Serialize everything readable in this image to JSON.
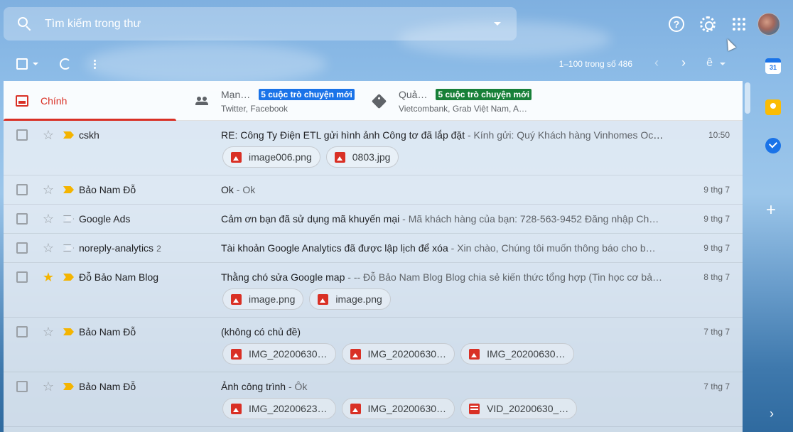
{
  "search": {
    "placeholder": "Tìm kiếm trong thư"
  },
  "header": {
    "help_icon": "help-icon",
    "settings_icon": "gear-icon",
    "apps_icon": "apps-icon"
  },
  "toolbar": {
    "pagination": "1–100 trong số 486"
  },
  "tabs": [
    {
      "name": "Chính",
      "badge": "",
      "subtitle": ""
    },
    {
      "name": "Mạn…",
      "badge": "5 cuộc trò chuyện mới",
      "subtitle": "Twitter, Facebook"
    },
    {
      "name": "Quả…",
      "badge": "5 cuộc trò chuyện mới",
      "subtitle": "Vietcombank, Grab Việt Nam, A…"
    }
  ],
  "emails": [
    {
      "sender": "cskh",
      "count": "",
      "starred": false,
      "important": true,
      "subject": "RE: Công Ty Điện ETL gửi hình ảnh Công tơ đã lắp đặt",
      "snippet": " - Kính gửi: Quý Khách hàng Vinhomes Oce…",
      "date": "10:50",
      "attachments": [
        {
          "name": "image006.png",
          "type": "img"
        },
        {
          "name": "0803.jpg",
          "type": "img"
        }
      ]
    },
    {
      "sender": "Bảo Nam Đỗ",
      "count": "",
      "starred": false,
      "important": true,
      "subject": "Ok",
      "snippet": " - Ok",
      "date": "9 thg 7",
      "attachments": []
    },
    {
      "sender": "Google Ads",
      "count": "",
      "starred": false,
      "important": false,
      "subject": "Cảm ơn bạn đã sử dụng mã khuyến mại",
      "snippet": " - Mã khách hàng của bạn: 728-563-9452 Đăng nhập Ch…",
      "date": "9 thg 7",
      "attachments": []
    },
    {
      "sender": "noreply-analytics",
      "count": "2",
      "starred": false,
      "important": false,
      "subject": "Tài khoản Google Analytics đã được lập lịch để xóa",
      "snippet": " - Xin chào, Chúng tôi muốn thông báo cho b…",
      "date": "9 thg 7",
      "attachments": []
    },
    {
      "sender": "Đỗ Bảo Nam Blog",
      "count": "",
      "starred": true,
      "important": true,
      "subject": "Thằng chó sửa Google map",
      "snippet": " - -- Đỗ Bảo Nam Blog Blog chia sẻ kiến thức tổng hợp (Tin học cơ bả…",
      "date": "8 thg 7",
      "attachments": [
        {
          "name": "image.png",
          "type": "img"
        },
        {
          "name": "image.png",
          "type": "img"
        }
      ]
    },
    {
      "sender": "Bảo Nam Đỗ",
      "count": "",
      "starred": false,
      "important": true,
      "subject": "(không có chủ đề)",
      "snippet": "",
      "date": "7 thg 7",
      "attachments": [
        {
          "name": "IMG_20200630…",
          "type": "img"
        },
        {
          "name": "IMG_20200630…",
          "type": "img"
        },
        {
          "name": "IMG_20200630…",
          "type": "img"
        }
      ]
    },
    {
      "sender": "Bảo Nam Đỗ",
      "count": "",
      "starred": false,
      "important": true,
      "subject": "Ảnh công trình",
      "snippet": " - Ôk",
      "date": "7 thg 7",
      "attachments": [
        {
          "name": "IMG_20200623…",
          "type": "img"
        },
        {
          "name": "IMG_20200630…",
          "type": "img"
        },
        {
          "name": "VID_20200630_…",
          "type": "vid"
        }
      ]
    }
  ],
  "side_panel": {
    "calendar_day": "31"
  },
  "colors": {
    "accent_red": "#d93025",
    "badge_blue": "#1a73e8",
    "badge_green": "#188038",
    "important_yellow": "#f4b400"
  }
}
